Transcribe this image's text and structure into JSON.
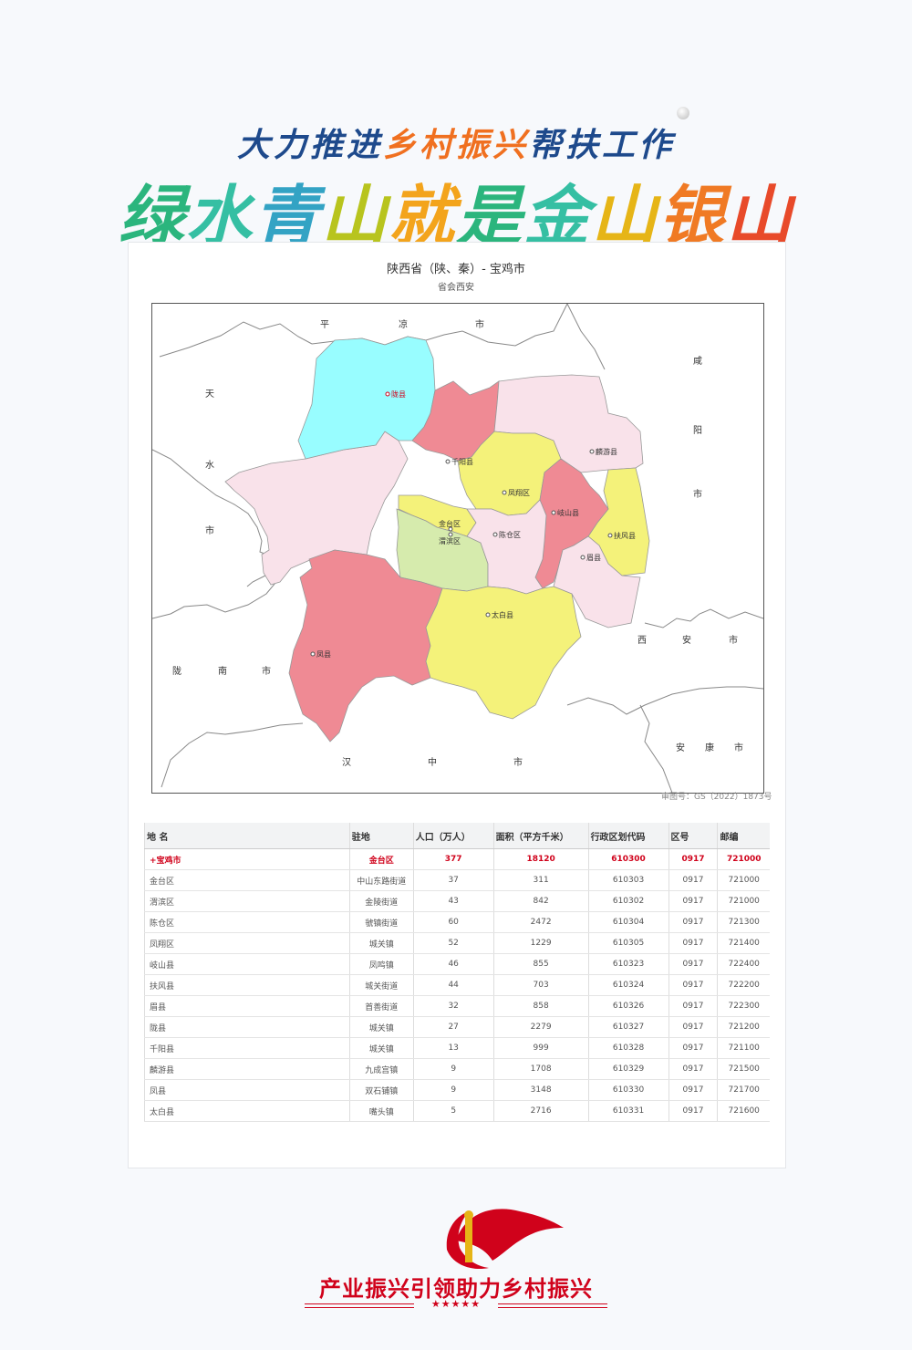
{
  "banner": {
    "top_pre": "大力推进",
    "top_highlight": "乡村振兴",
    "top_post": "帮扶工作",
    "main": [
      "绿",
      "水",
      "青",
      "山",
      "就",
      "是",
      "金",
      "山",
      "银",
      "山"
    ],
    "main_colors": [
      "#2bb57d",
      "#35bfa3",
      "#33a3c4",
      "#b8c41e",
      "#f3a41c",
      "#2bb57d",
      "#35bfa3",
      "#e6b517",
      "#f07a24",
      "#e84a2a"
    ]
  },
  "map": {
    "title": "陕西省（陕、秦）- 宝鸡市",
    "subtitle": "省会西安",
    "review_no": "审图号：GS（2022）1873号",
    "neighbors": {
      "pingliang": [
        "平",
        "凉",
        "市"
      ],
      "tianshui": [
        "天",
        "水",
        "市"
      ],
      "xianyang": [
        "咸",
        "阳",
        "市"
      ],
      "longnan": [
        "陇",
        "南",
        "市"
      ],
      "xian": [
        "西",
        "安",
        "市"
      ],
      "hanzhong": [
        "汉",
        "中",
        "市"
      ],
      "ankang": [
        "安",
        "康",
        "市"
      ]
    },
    "places": {
      "long": "陇县",
      "qianyang": "千阳县",
      "linyou": "麟游县",
      "fengxiang": "凤翔区",
      "qishan": "岐山县",
      "fufeng": "扶风县",
      "jintai": "金台区",
      "weibin": "渭滨区",
      "chencang": "陈仓区",
      "mei": "眉县",
      "taibai": "太白县",
      "feng": "凤县"
    },
    "colors": {
      "cyan": "#98fdff",
      "red": "#ef8a94",
      "yellow": "#f4f27a",
      "pink": "#f9e2ea",
      "green": "#d6ebad"
    }
  },
  "table": {
    "headers": [
      "地 名",
      "驻地",
      "人口（万人）",
      "面积（平方千米）",
      "行政区划代码",
      "区号",
      "邮编"
    ],
    "rows": [
      [
        "+宝鸡市",
        "金台区",
        "377",
        "18120",
        "610300",
        "0917",
        "721000"
      ],
      [
        "金台区",
        "中山东路街道",
        "37",
        "311",
        "610303",
        "0917",
        "721000"
      ],
      [
        "渭滨区",
        "金陵街道",
        "43",
        "842",
        "610302",
        "0917",
        "721000"
      ],
      [
        "陈仓区",
        "虢镇街道",
        "60",
        "2472",
        "610304",
        "0917",
        "721300"
      ],
      [
        "凤翔区",
        "城关镇",
        "52",
        "1229",
        "610305",
        "0917",
        "721400"
      ],
      [
        "岐山县",
        "凤鸣镇",
        "46",
        "855",
        "610323",
        "0917",
        "722400"
      ],
      [
        "扶风县",
        "城关街道",
        "44",
        "703",
        "610324",
        "0917",
        "722200"
      ],
      [
        "眉县",
        "首善街道",
        "32",
        "858",
        "610326",
        "0917",
        "722300"
      ],
      [
        "陇县",
        "城关镇",
        "27",
        "2279",
        "610327",
        "0917",
        "721200"
      ],
      [
        "千阳县",
        "城关镇",
        "13",
        "999",
        "610328",
        "0917",
        "721100"
      ],
      [
        "麟游县",
        "九成宫镇",
        "9",
        "1708",
        "610329",
        "0917",
        "721500"
      ],
      [
        "凤县",
        "双石铺镇",
        "9",
        "3148",
        "610330",
        "0917",
        "721700"
      ],
      [
        "太白县",
        "嘴头镇",
        "5",
        "2716",
        "610331",
        "0917",
        "721600"
      ]
    ]
  },
  "footer": {
    "title": "产业振兴引领助力乡村振兴",
    "stars": "★★★★★"
  }
}
